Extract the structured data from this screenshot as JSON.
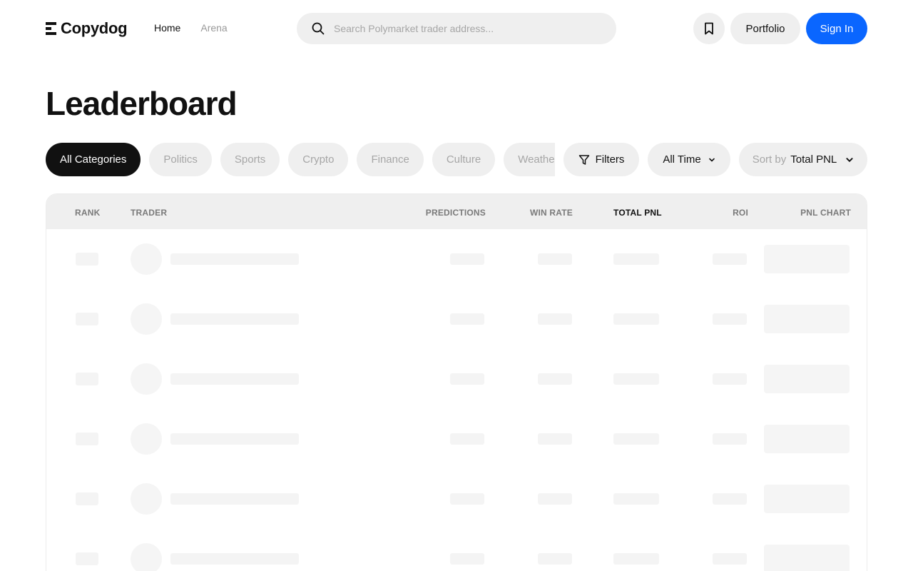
{
  "brand": {
    "name": "Copydog"
  },
  "nav": {
    "home": "Home",
    "arena": "Arena"
  },
  "search": {
    "placeholder": "Search Polymarket trader address..."
  },
  "header_actions": {
    "portfolio": "Portfolio",
    "sign_in": "Sign In"
  },
  "page": {
    "title": "Leaderboard"
  },
  "categories": [
    "All Categories",
    "Politics",
    "Sports",
    "Crypto",
    "Finance",
    "Culture",
    "Weather"
  ],
  "active_category": "All Categories",
  "controls": {
    "filters": "Filters",
    "time_range": "All Time",
    "sort_prefix": "Sort by",
    "sort_value": "Total PNL"
  },
  "table": {
    "columns": {
      "rank": "RANK",
      "trader": "TRADER",
      "predictions": "PREDICTIONS",
      "win_rate": "WIN RATE",
      "total_pnl": "TOTAL PNL",
      "roi": "ROI",
      "pnl_chart": "PNL CHART"
    },
    "sorted_column": "total_pnl",
    "loading_rows": 6
  },
  "colors": {
    "accent": "#0a66ff",
    "active_pill": "#111111",
    "pill_bg": "#efefef"
  },
  "icons": {
    "search": "search-icon",
    "bookmark": "bookmark-icon",
    "filter": "filter-icon",
    "chevron": "chevron-down-icon"
  }
}
